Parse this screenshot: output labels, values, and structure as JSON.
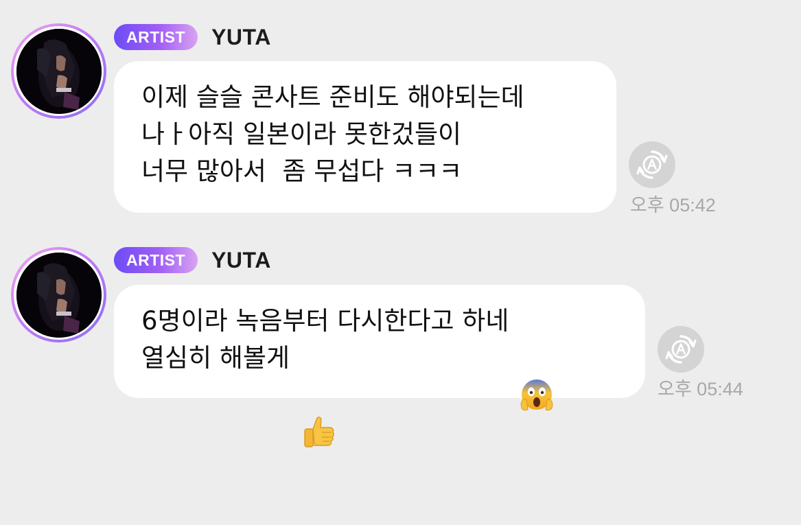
{
  "messages": [
    {
      "badge": "ARTIST",
      "sender": "YUTA",
      "lines": [
        "이제 슬슬 콘사트 준비도 해야되는데",
        "나ㅏ아직 일본이라 못한겄들이",
        "너무 많아서  좀 무섭다 ㅋㅋㅋ"
      ],
      "time": "오후 05:42",
      "translate_icon": "translate-icon"
    },
    {
      "badge": "ARTIST",
      "sender": "YUTA",
      "lines": [
        "6명이라 녹음부터 다시한다고 하네",
        "열심히 해볼게"
      ],
      "emojis": [
        "face-screaming-in-fear-emoji",
        "thumbs-up-emoji"
      ],
      "time": "오후 05:44",
      "translate_icon": "translate-icon"
    }
  ],
  "colors": {
    "background": "#ededed",
    "bubble": "#ffffff",
    "badge_gradient_start": "#6d4cf5",
    "badge_gradient_end": "#d8a3f2",
    "timestamp": "#a8a8a8"
  }
}
